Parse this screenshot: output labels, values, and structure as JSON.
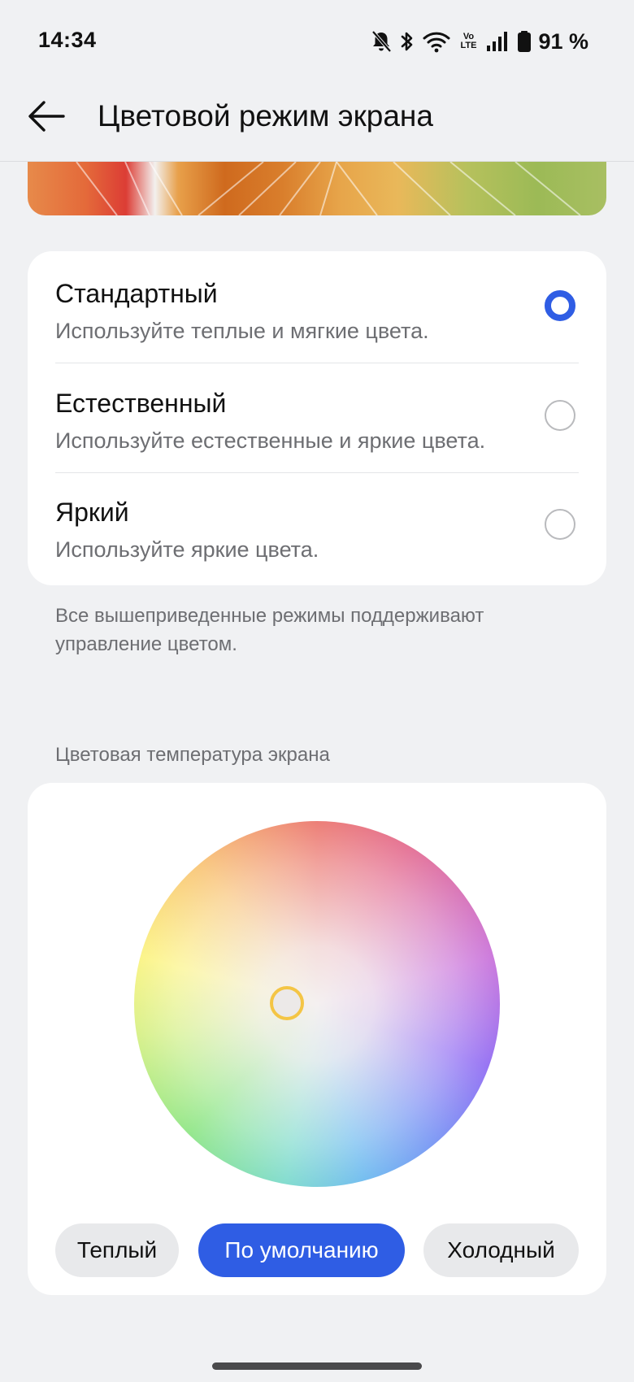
{
  "status_bar": {
    "time": "14:34",
    "volte_top": "Vo",
    "volte_bottom": "LTE",
    "battery": "91 %",
    "icons": [
      "bell-muted-icon",
      "bluetooth-icon",
      "wifi-icon",
      "volte-icon",
      "signal-icon",
      "battery-icon"
    ]
  },
  "header": {
    "back_icon": "arrow-left-icon",
    "title": "Цветовой режим экрана"
  },
  "modes": [
    {
      "title": "Стандартный",
      "subtitle": "Используйте теплые и мягкие цвета.",
      "selected": true
    },
    {
      "title": "Естественный",
      "subtitle": "Используйте естественные и яркие цвета.",
      "selected": false
    },
    {
      "title": "Яркий",
      "subtitle": "Используйте яркие цвета.",
      "selected": false
    }
  ],
  "footnote": "Все вышеприведенные режимы поддерживают управление цветом.",
  "temperature": {
    "section_label": "Цветовая температура экрана",
    "presets": [
      {
        "label": "Теплый",
        "active": false
      },
      {
        "label": "По умолчанию",
        "active": true
      },
      {
        "label": "Холодный",
        "active": false
      }
    ]
  },
  "colors": {
    "accent": "#2f5de4",
    "background": "#f0f1f3",
    "card": "#ffffff",
    "secondary_text": "#6d6e72",
    "handle_ring": "#f4c545"
  }
}
